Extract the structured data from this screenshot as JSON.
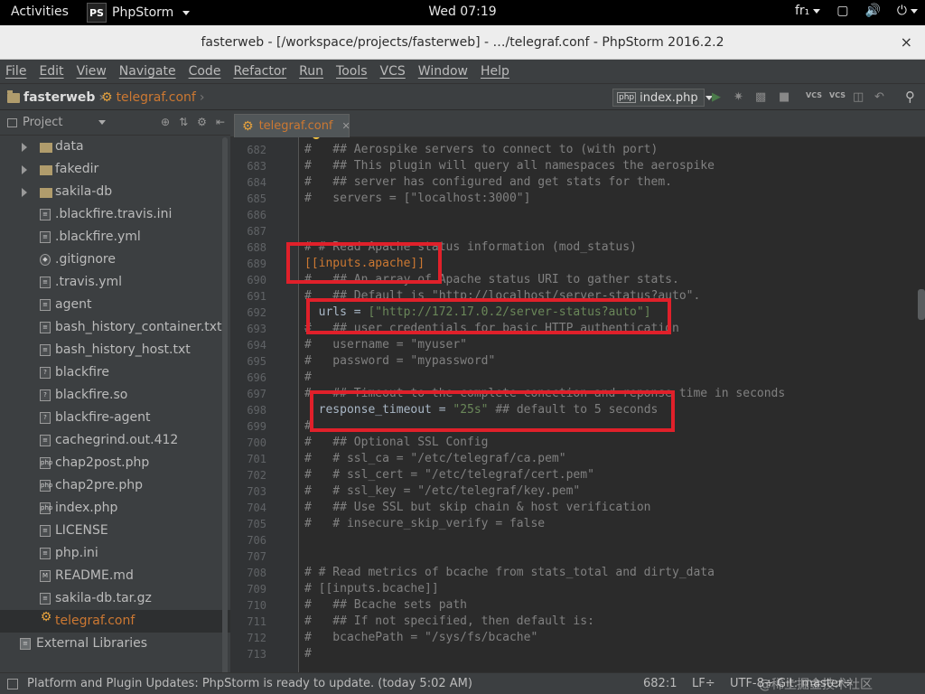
{
  "topbar": {
    "activities": "Activities",
    "app_logo": "PS",
    "app_name": "PhpStorm",
    "clock": "Wed 07:19",
    "input_method": "fr₁"
  },
  "window": {
    "title": "fasterweb - [/workspace/projects/fasterweb] - …/telegraf.conf - PhpStorm 2016.2.2",
    "close": "×"
  },
  "menu": [
    "File",
    "Edit",
    "View",
    "Navigate",
    "Code",
    "Refactor",
    "Run",
    "Tools",
    "VCS",
    "Window",
    "Help"
  ],
  "navbar": {
    "project": "fasterweb",
    "file": "telegraf.conf",
    "run_config": "index.php",
    "vcs1": "VCS",
    "vcs2": "VCS"
  },
  "project_panel": {
    "title": "Project",
    "items": [
      {
        "label": "data",
        "type": "folder",
        "expandable": true
      },
      {
        "label": "fakedir",
        "type": "folder",
        "expandable": true
      },
      {
        "label": "sakila-db",
        "type": "folder",
        "expandable": true
      },
      {
        "label": ".blackfire.travis.ini",
        "type": "config"
      },
      {
        "label": ".blackfire.yml",
        "type": "yml"
      },
      {
        "label": ".gitignore",
        "type": "git"
      },
      {
        "label": ".travis.yml",
        "type": "yml"
      },
      {
        "label": "agent",
        "type": "text"
      },
      {
        "label": "bash_history_container.txt",
        "type": "text"
      },
      {
        "label": "bash_history_host.txt",
        "type": "text"
      },
      {
        "label": "blackfire",
        "type": "unknown"
      },
      {
        "label": "blackfire.so",
        "type": "unknown"
      },
      {
        "label": "blackfire-agent",
        "type": "unknown"
      },
      {
        "label": "cachegrind.out.412",
        "type": "text"
      },
      {
        "label": "chap2post.php",
        "type": "php"
      },
      {
        "label": "chap2pre.php",
        "type": "php"
      },
      {
        "label": "index.php",
        "type": "php"
      },
      {
        "label": "LICENSE",
        "type": "text"
      },
      {
        "label": "php.ini",
        "type": "config"
      },
      {
        "label": "README.md",
        "type": "md"
      },
      {
        "label": "sakila-db.tar.gz",
        "type": "archive"
      },
      {
        "label": "telegraf.conf",
        "type": "gear",
        "selected": true
      }
    ],
    "external": "External Libraries"
  },
  "editor": {
    "tab": "telegraf.conf",
    "lines": [
      {
        "n": "682",
        "text": "#   ## Aerospike servers to connect to (with port)"
      },
      {
        "n": "683",
        "text": "#   ## This plugin will query all namespaces the aerospike"
      },
      {
        "n": "684",
        "text": "#   ## server has configured and get stats for them."
      },
      {
        "n": "685",
        "text": "#   servers = [\"localhost:3000\"]"
      },
      {
        "n": "686",
        "text": ""
      },
      {
        "n": "687",
        "text": ""
      },
      {
        "n": "688",
        "text": "# # Read Apache status information (mod_status)"
      },
      {
        "n": "689",
        "text": "[[inputs.apache]]",
        "style": "strong"
      },
      {
        "n": "690",
        "text": "#   ## An array of Apache status URI to gather stats."
      },
      {
        "n": "691",
        "text": "#   ## Default is \"http://localhost/server-status?auto\"."
      },
      {
        "n": "692",
        "text": "  urls = ",
        "style": "key",
        "value": "[\"http://172.17.0.2/server-status?auto\"]"
      },
      {
        "n": "693",
        "text": "#   ## user credentials for basic HTTP authentication"
      },
      {
        "n": "694",
        "text": "#   username = \"myuser\""
      },
      {
        "n": "695",
        "text": "#   password = \"mypassword\""
      },
      {
        "n": "696",
        "text": "#"
      },
      {
        "n": "697",
        "text": "#   ## Timeout to the complete conection and reponse time in seconds"
      },
      {
        "n": "698",
        "text": "  response_timeout = ",
        "style": "key",
        "value": "\"25s\"",
        "comment": " ## default to 5 seconds"
      },
      {
        "n": "699",
        "text": "#"
      },
      {
        "n": "700",
        "text": "#   ## Optional SSL Config"
      },
      {
        "n": "701",
        "text": "#   # ssl_ca = \"/etc/telegraf/ca.pem\""
      },
      {
        "n": "702",
        "text": "#   # ssl_cert = \"/etc/telegraf/cert.pem\""
      },
      {
        "n": "703",
        "text": "#   # ssl_key = \"/etc/telegraf/key.pem\""
      },
      {
        "n": "704",
        "text": "#   ## Use SSL but skip chain & host verification"
      },
      {
        "n": "705",
        "text": "#   # insecure_skip_verify = false"
      },
      {
        "n": "706",
        "text": ""
      },
      {
        "n": "707",
        "text": ""
      },
      {
        "n": "708",
        "text": "# # Read metrics of bcache from stats_total and dirty_data"
      },
      {
        "n": "709",
        "text": "# [[inputs.bcache]]"
      },
      {
        "n": "710",
        "text": "#   ## Bcache sets path"
      },
      {
        "n": "711",
        "text": "#   ## If not specified, then default is:"
      },
      {
        "n": "712",
        "text": "#   bcachePath = \"/sys/fs/bcache\""
      },
      {
        "n": "713",
        "text": "#"
      }
    ]
  },
  "status": {
    "message": "Platform and Plugin Updates: PhpStorm is ready to update. (today 5:02 AM)",
    "position": "682:1",
    "line_sep": "LF÷",
    "encoding": "UTF-8÷",
    "git": "Git: master÷",
    "watermark": "@稀土掘金技术社区"
  },
  "colors": {
    "highlight_box": "#e0202a",
    "accent_file": "#cc7832",
    "string": "#6a8759",
    "comment": "#808080"
  }
}
